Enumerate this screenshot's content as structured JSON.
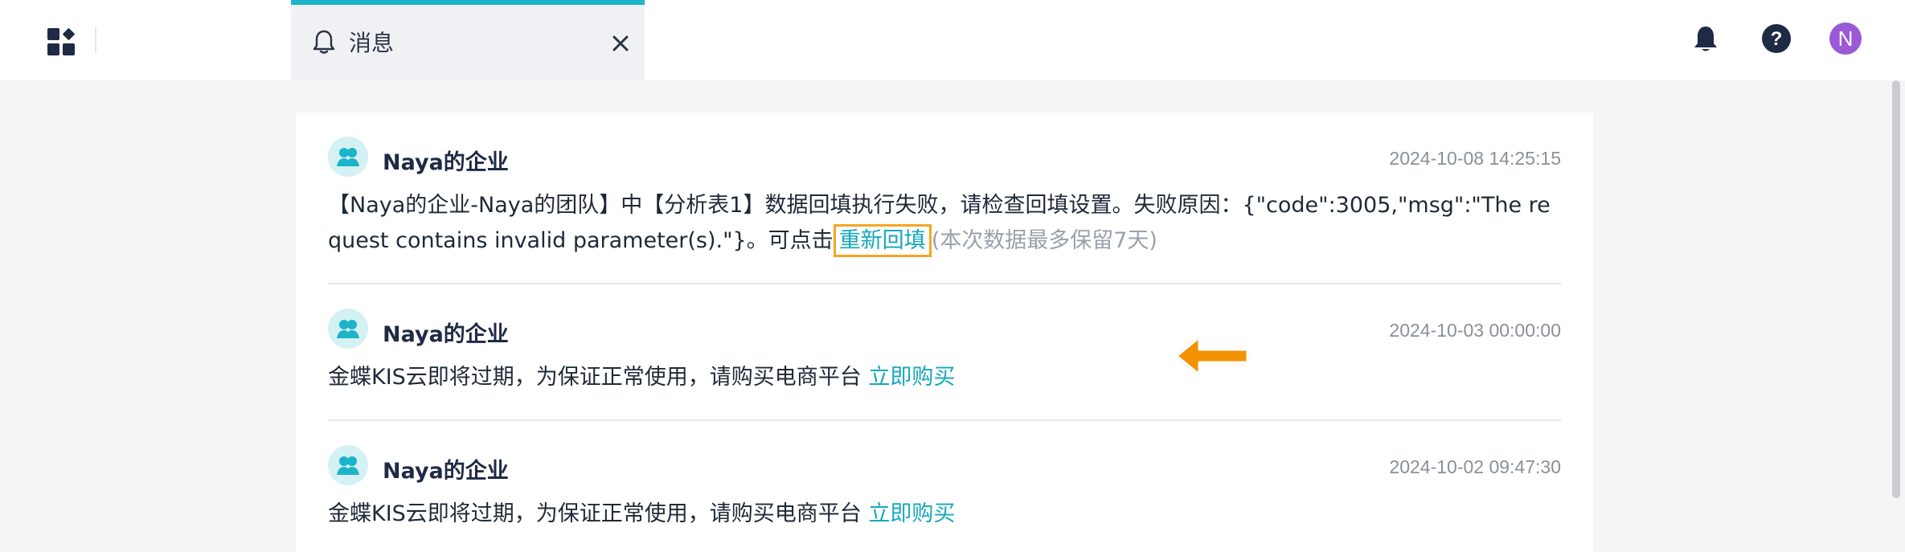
{
  "tab": {
    "label": "消息"
  },
  "header": {
    "avatar_letter": "N"
  },
  "messages": [
    {
      "org": "Naya的企业",
      "time": "2024-10-08 14:25:15",
      "text_before": "【Naya的企业-Naya的团队】中【分析表1】数据回填执行失败，请检查回填设置。失败原因：{\"code\":3005,\"msg\":\"The request contains invalid parameter(s).\"}。可点击",
      "link": "重新回填",
      "text_after": "(本次数据最多保留7天)"
    },
    {
      "org": "Naya的企业",
      "time": "2024-10-03 00:00:00",
      "text": "金蝶KIS云即将过期，为保证正常使用，请购买电商平台 ",
      "link": "立即购买"
    },
    {
      "org": "Naya的企业",
      "time": "2024-10-02 09:47:30",
      "text": "金蝶KIS云即将过期，为保证正常使用，请购买电商平台 ",
      "link": "立即购买"
    }
  ],
  "colors": {
    "accent": "#15a8bb",
    "highlight": "#f5a623",
    "avatar": "#9b59d6"
  },
  "icons": [
    "apps-icon",
    "bell-icon",
    "close-icon",
    "notification-bell-icon",
    "help-icon",
    "team-icon",
    "arrow-left-icon"
  ]
}
